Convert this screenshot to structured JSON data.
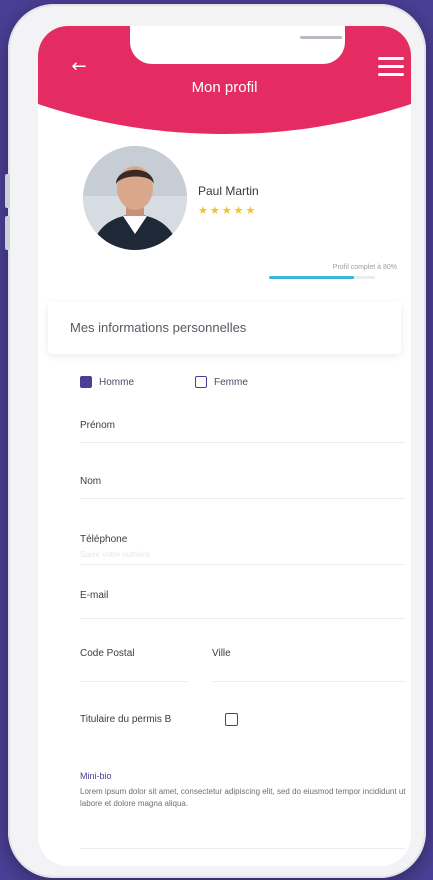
{
  "colors": {
    "background": "#4a3f95",
    "header": "#e42c62",
    "accent": "#4a3f95",
    "progress": "#3bb7d8",
    "stars": "#f2c230"
  },
  "header": {
    "title": "Mon profil",
    "back_icon": "arrow-left-icon",
    "menu_icon": "hamburger-menu-icon"
  },
  "profile": {
    "name": "Paul Martin",
    "stars": "★★★★★",
    "rating": 5,
    "progress_label": "Profil complet à 80%",
    "progress_value": 0.8
  },
  "section": {
    "title": "Mes informations personnelles"
  },
  "gender": {
    "male": "Homme",
    "female": "Femme",
    "selected": "Homme"
  },
  "fields": {
    "prenom": "Prénom",
    "nom": "Nom",
    "telephone": "Téléphone",
    "telephone_placeholder": "Saisir votre numéro",
    "email": "E-mail",
    "code_postal": "Code Postal",
    "ville": "Ville",
    "permis": "Titulaire du permis B"
  },
  "bio": {
    "label": "Mini-bio",
    "text": "Lorem ipsum dolor sit amet, consectetur adipiscing elit, sed do eiusmod tempor incididunt ut labore et dolore magna aliqua."
  }
}
